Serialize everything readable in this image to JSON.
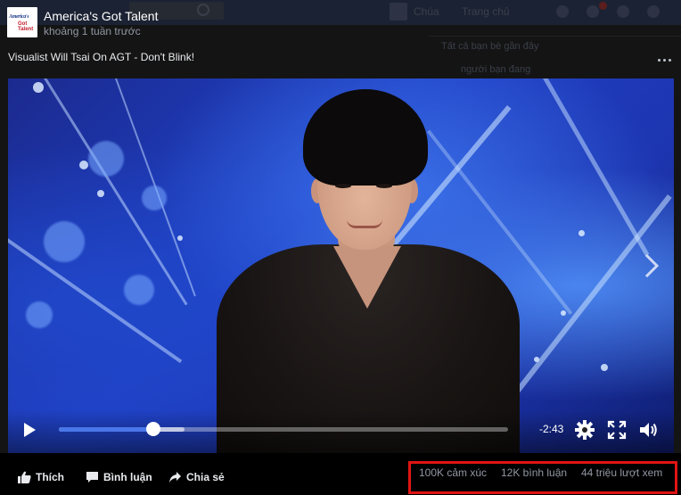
{
  "background_page": {
    "nav_items": [
      "Chúa",
      "Trang chủ"
    ],
    "right_panel_lines": [
      "Tất cả bạn bè gần đây",
      "người bạn đang"
    ]
  },
  "post": {
    "page_name": "America's Got Talent",
    "logo_text_top": "America's",
    "logo_text_bottom": "Got Talent",
    "time": "khoảng 1 tuần trước",
    "title": "Visualist Will Tsai On AGT - Don't Blink!"
  },
  "player": {
    "time_remaining": "-2:43",
    "progress_fraction": 0.21,
    "buffered_fraction": 0.28,
    "icons": [
      "play-icon",
      "settings-icon",
      "fullscreen-icon",
      "volume-icon",
      "next-arrow-icon"
    ]
  },
  "actions": {
    "like_label": "Thích",
    "comment_label": "Bình luận",
    "share_label": "Chia sẻ"
  },
  "stats": {
    "reactions": "100K cảm xúc",
    "comments": "12K bình luận",
    "views": "44 triệu lượt xem"
  },
  "colors": {
    "highlight_box": "#e01414",
    "progress": "#4a76e8",
    "muted_text": "#9197a3"
  }
}
